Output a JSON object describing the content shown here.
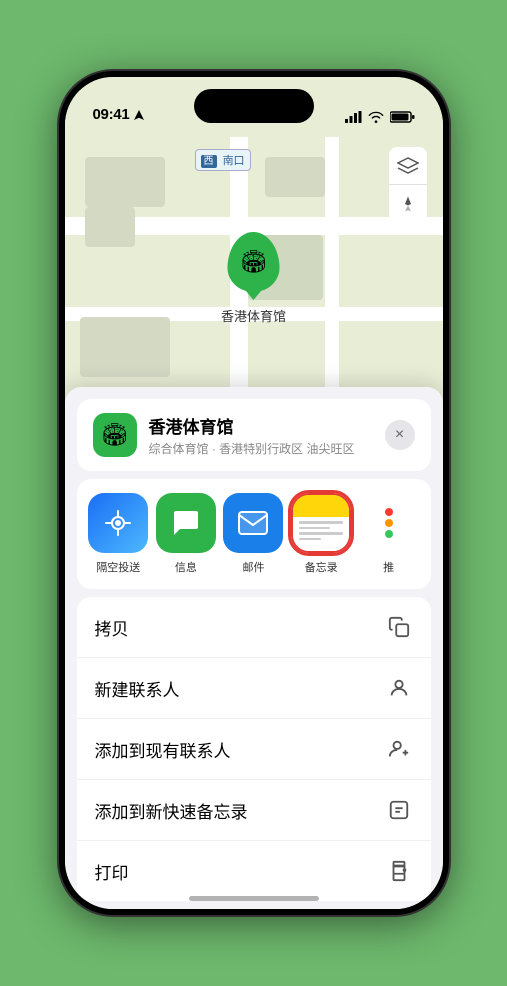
{
  "status_bar": {
    "time": "09:41",
    "location_arrow": true
  },
  "map": {
    "label_text": "南口",
    "label_prefix": "西",
    "controls": {
      "layers_icon": "🗺",
      "location_icon": "➤"
    },
    "marker": {
      "label": "香港体育馆"
    }
  },
  "location_card": {
    "name": "香港体育馆",
    "subtitle": "综合体育馆 · 香港特别行政区 油尖旺区",
    "close_label": "×"
  },
  "share_actions": [
    {
      "id": "airdrop",
      "label": "隔空投送"
    },
    {
      "id": "messages",
      "label": "信息"
    },
    {
      "id": "mail",
      "label": "邮件"
    },
    {
      "id": "notes",
      "label": "备忘录",
      "highlighted": true
    },
    {
      "id": "more",
      "label": "推"
    }
  ],
  "menu_items": [
    {
      "id": "copy",
      "label": "拷贝",
      "icon": "copy"
    },
    {
      "id": "new-contact",
      "label": "新建联系人",
      "icon": "person"
    },
    {
      "id": "add-existing",
      "label": "添加到现有联系人",
      "icon": "person-add"
    },
    {
      "id": "add-notes",
      "label": "添加到新快速备忘录",
      "icon": "note"
    },
    {
      "id": "print",
      "label": "打印",
      "icon": "print"
    }
  ]
}
